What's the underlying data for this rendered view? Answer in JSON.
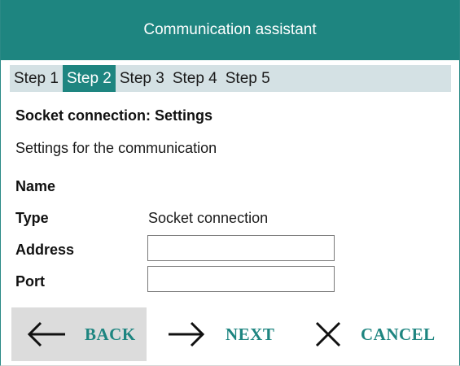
{
  "window": {
    "title": "Communication assistant"
  },
  "steps": [
    {
      "label": "Step 1",
      "active": false
    },
    {
      "label": "Step 2",
      "active": true
    },
    {
      "label": "Step 3",
      "active": false
    },
    {
      "label": "Step 4",
      "active": false
    },
    {
      "label": "Step 5",
      "active": false
    }
  ],
  "main": {
    "heading": "Socket connection: Settings",
    "subheading": "Settings for the communication",
    "fields": {
      "name": {
        "label": "Name",
        "value": ""
      },
      "type": {
        "label": "Type",
        "value": "Socket connection"
      },
      "address": {
        "label": "Address",
        "value": "",
        "placeholder": ""
      },
      "port": {
        "label": "Port",
        "value": "",
        "placeholder": ""
      }
    }
  },
  "buttons": {
    "back": {
      "label": "BACK",
      "icon": "arrow-left-icon"
    },
    "next": {
      "label": "NEXT",
      "icon": "arrow-right-icon"
    },
    "cancel": {
      "label": "CANCEL",
      "icon": "close-icon"
    }
  },
  "colors": {
    "accent": "#1e8580",
    "step_bar": "#d4e1e4",
    "back_button_bg": "#dcdcdc"
  }
}
